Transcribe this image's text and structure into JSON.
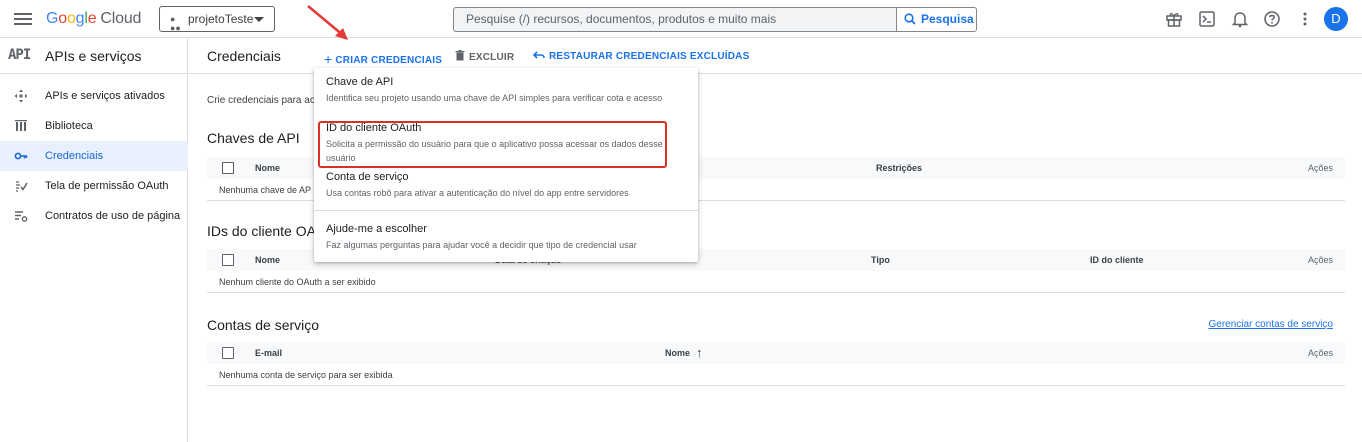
{
  "header": {
    "logo_parts": [
      "G",
      "o",
      "o",
      "g",
      "l",
      "e"
    ],
    "logo_cloud": "Cloud",
    "project": "projetoTeste",
    "search_placeholder": "Pesquise (/) recursos, documentos, produtos e muito mais",
    "search_button": "Pesquisa",
    "avatar": "D",
    "icons": [
      "gift-icon",
      "terminal-icon",
      "bell-icon",
      "help-icon",
      "more-vert-icon"
    ]
  },
  "sidebar": {
    "logo": "API",
    "title": "APIs e serviços",
    "items": [
      {
        "label": "APIs e serviços ativados",
        "icon": "diamond-arrows-icon"
      },
      {
        "label": "Biblioteca",
        "icon": "library-icon"
      },
      {
        "label": "Credenciais",
        "icon": "key-icon",
        "active": true
      },
      {
        "label": "Tela de permissão OAuth",
        "icon": "consent-icon"
      },
      {
        "label": "Contratos de uso de página",
        "icon": "settings-list-icon"
      }
    ]
  },
  "main": {
    "title": "Credenciais",
    "actions": {
      "create": "CRIAR CREDENCIAIS",
      "delete": "EXCLUIR",
      "restore": "RESTAURAR CREDENCIAIS EXCLUÍDAS"
    },
    "intro": "Crie credenciais para ace",
    "api_keys": {
      "title": "Chaves de API",
      "columns": [
        "Nome",
        "Restrições",
        "Ações"
      ],
      "empty": "Nenhuma chave de AP"
    },
    "oauth": {
      "title": "IDs do cliente OAu",
      "columns": [
        "Nome",
        "Data de criação",
        "Tipo",
        "ID do cliente",
        "Ações"
      ],
      "empty": "Nenhum cliente do OAuth a ser exibido"
    },
    "service_accounts": {
      "title": "Contas de serviço",
      "manage_link": "Gerenciar contas de serviço",
      "columns": [
        "E-mail",
        "Nome",
        "Ações"
      ],
      "sort_arrow": "↑",
      "empty": "Nenhuma conta de serviço para ser exibida"
    }
  },
  "dropdown": {
    "options": [
      {
        "title": "Chave de API",
        "desc": "Identifica seu projeto usando uma chave de API simples para verificar cota e acesso"
      },
      {
        "title": "ID do cliente OAuth",
        "desc": "Solicita a permissão do usuário para que o aplicativo possa acessar os dados desse usuário",
        "highlighted": true
      },
      {
        "title": "Conta de serviço",
        "desc": "Usa contas robô para ativar a autenticação do nível do app entre servidores"
      },
      {
        "title": "Ajude-me a escolher",
        "desc": "Faz algumas perguntas para ajudar você a decidir que tipo de credencial usar"
      }
    ]
  },
  "colors": {
    "accent": "#1a73e8",
    "highlight_box": "#d93025",
    "arrow": "#e53935",
    "active_nav_bg": "#e8f0fe"
  }
}
